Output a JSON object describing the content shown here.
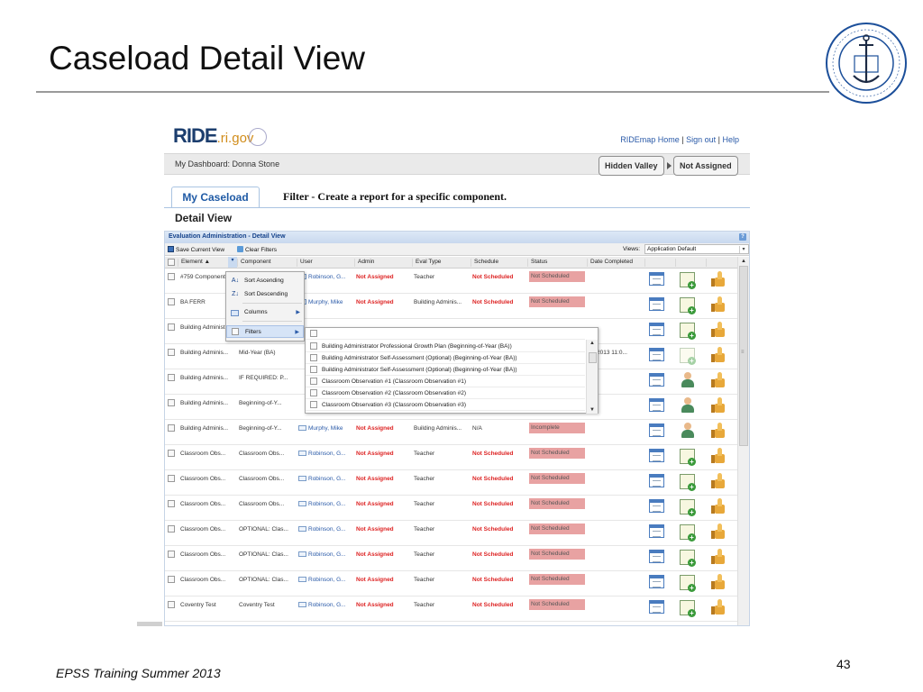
{
  "slide": {
    "title": "Caseload Detail View",
    "footer": "EPSS Training Summer 2013",
    "page_number": "43",
    "seal_icon": "ri-board-of-regents-seal-icon"
  },
  "app": {
    "logo_main": "RIDE",
    "logo_tld": ".ri.gov",
    "links": [
      "RIDEmap Home",
      "Sign out",
      "Help"
    ],
    "dashboard_label": "My Dashboard: Donna Stone",
    "breadcrumb_pills": [
      "Hidden Valley",
      "Not Assigned"
    ],
    "tab_label": "My Caseload",
    "filter_caption": "Filter - Create a report for a specific component.",
    "detail_title": "Detail View"
  },
  "grid": {
    "header": "Evaluation Administration - Detail View",
    "help_label": "?",
    "toolbar": {
      "save": "Save Current View",
      "clear": "Clear Filters",
      "views_label": "Views:",
      "views_value": "Application Default"
    },
    "columns": [
      "Element ▲",
      "Component",
      "User",
      "Admin",
      "Eval Type",
      "Schedule",
      "Status",
      "Date Completed"
    ],
    "rows": [
      {
        "element": "#759 Component",
        "component": "",
        "user": "Robinson, G...",
        "admin": "Not Assigned",
        "eval": "Teacher",
        "schedule": "Not Scheduled",
        "status": "Not Scheduled",
        "date": "",
        "mid": "cal"
      },
      {
        "element": "BA FERR",
        "component": "",
        "user": "Murphy, Mike",
        "admin": "Not Assigned",
        "eval": "Building Adminis...",
        "schedule": "Not Scheduled",
        "status": "Not Scheduled",
        "date": "",
        "mid": "cal"
      },
      {
        "element": "Building Administ...",
        "component": "",
        "user": "",
        "admin": "",
        "eval": "",
        "schedule": "",
        "status": "",
        "date": "",
        "mid": "cal"
      },
      {
        "element": "Building Adminis...",
        "component": "Mid-Year (BA)",
        "user": "",
        "admin": "",
        "eval": "",
        "schedule": "",
        "status": "",
        "date": "06/2013 11:0...",
        "mid": "cal-faded"
      },
      {
        "element": "Building Adminis...",
        "component": "IF REQUIRED: P...",
        "user": "",
        "admin": "",
        "eval": "",
        "schedule": "",
        "status": "",
        "date": "",
        "mid": "person"
      },
      {
        "element": "Building Adminis...",
        "component": "Beginning-of-Y...",
        "user": "",
        "admin": "",
        "eval": "",
        "schedule": "",
        "status": "",
        "date": "",
        "mid": "person"
      },
      {
        "element": "Building Adminis...",
        "component": "Beginning-of-Y...",
        "user": "Murphy, Mike",
        "admin": "Not Assigned",
        "eval": "Building Adminis...",
        "schedule": "N/A",
        "status": "Incomplete",
        "date": "",
        "mid": "person"
      },
      {
        "element": "Classroom Obs...",
        "component": "Classroom Obs...",
        "user": "Robinson, G...",
        "admin": "Not Assigned",
        "eval": "Teacher",
        "schedule": "Not Scheduled",
        "status": "Not Scheduled",
        "date": "",
        "mid": "cal"
      },
      {
        "element": "Classroom Obs...",
        "component": "Classroom Obs...",
        "user": "Robinson, G...",
        "admin": "Not Assigned",
        "eval": "Teacher",
        "schedule": "Not Scheduled",
        "status": "Not Scheduled",
        "date": "",
        "mid": "cal"
      },
      {
        "element": "Classroom Obs...",
        "component": "Classroom Obs...",
        "user": "Robinson, G...",
        "admin": "Not Assigned",
        "eval": "Teacher",
        "schedule": "Not Scheduled",
        "status": "Not Scheduled",
        "date": "",
        "mid": "cal"
      },
      {
        "element": "Classroom Obs...",
        "component": "OPTIONAL: Clas...",
        "user": "Robinson, G...",
        "admin": "Not Assigned",
        "eval": "Teacher",
        "schedule": "Not Scheduled",
        "status": "Not Scheduled",
        "date": "",
        "mid": "cal"
      },
      {
        "element": "Classroom Obs...",
        "component": "OPTIONAL: Clas...",
        "user": "Robinson, G...",
        "admin": "Not Assigned",
        "eval": "Teacher",
        "schedule": "Not Scheduled",
        "status": "Not Scheduled",
        "date": "",
        "mid": "cal"
      },
      {
        "element": "Classroom Obs...",
        "component": "OPTIONAL: Clas...",
        "user": "Robinson, G...",
        "admin": "Not Assigned",
        "eval": "Teacher",
        "schedule": "Not Scheduled",
        "status": "Not Scheduled",
        "date": "",
        "mid": "cal"
      },
      {
        "element": "Coventry Test",
        "component": "Coventry Test",
        "user": "Robinson, G...",
        "admin": "Not Assigned",
        "eval": "Teacher",
        "schedule": "Not Scheduled",
        "status": "Not Scheduled",
        "date": "",
        "mid": "cal"
      }
    ]
  },
  "column_menu": {
    "items": [
      "Sort Ascending",
      "Sort Descending",
      "Columns",
      "Filters"
    ]
  },
  "filter_submenu": {
    "options": [
      "",
      "Building Administrator Professional Growth Plan (Beginning-of-Year (BA))",
      "Building Administrator Self-Assessment (Optional) (Beginning-of-Year (BA))",
      "Building Administrator Self-Assessment (Optional) (Beginning-of-Year (BA))",
      "Classroom Observation #1 (Classroom Observation #1)",
      "Classroom Observation #2 (Classroom Observation #2)",
      "Classroom Observation #3 (Classroom Observation #3)"
    ]
  },
  "colors": {
    "accent": "#15428b",
    "status_bg": "#e8a2a2",
    "not_assigned": "#dd2222"
  }
}
